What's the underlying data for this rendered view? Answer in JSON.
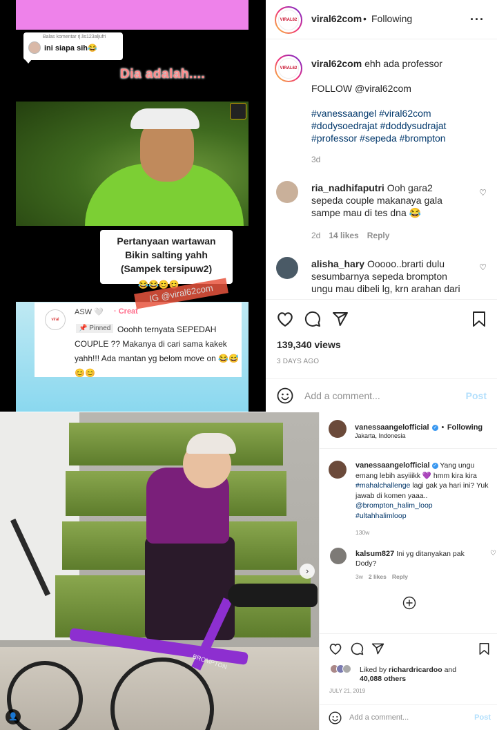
{
  "post1": {
    "media": {
      "reply_context": "Balas komentar rj.lis123aljufri",
      "reply_text": "ini siapa sih😂",
      "headline": "Dia adalah....",
      "caption_lines": [
        "Pertanyaan wartawan",
        "Bikin salting yahh",
        "(Sampek tersipuw2)"
      ],
      "caption_emojis": "😂😂😊😊",
      "watermark": "IG @viral62com",
      "pinned_author": "ASW 🤍",
      "pinned_creator": "· Creat",
      "pinned_label": "📌 Pinned",
      "pinned_text": "Ooohh ternyata SEPEDAH COUPLE ?? Makanya di cari sama kakek yahh!!! Ada mantan yg belom move on 😂😅😊😊",
      "avatar_label": "viral"
    },
    "header": {
      "username": "viral62com",
      "follow_status": "Following",
      "avatar_label": "VIRAL62"
    },
    "caption": {
      "username": "viral62com",
      "text": "ehh ada professor",
      "follow_line": "FOLLOW @viral62com",
      "hashtags": "#vanessaangel #viral62com #dodysoedrajat #doddysudrajat #professor #sepeda #brompton",
      "time": "3d"
    },
    "comments": [
      {
        "username": "ria_nadhifaputri",
        "text": "Ooh gara2 sepeda couple makanaya gala sampe mau di tes dna 😂",
        "time": "2d",
        "likes": "14 likes",
        "reply": "Reply"
      },
      {
        "username": "alisha_hary",
        "text": "Ooooo..brarti dulu sesumbarnya sepeda brompton ungu mau dibeli lg, krn arahan dari",
        "time": "",
        "likes": "",
        "reply": ""
      }
    ],
    "views": "139,340 views",
    "ago": "3 DAYS AGO",
    "add_comment_placeholder": "Add a comment...",
    "post_label": "Post"
  },
  "post2": {
    "header": {
      "username": "vanessaangelofficial",
      "follow_status": "Following",
      "location": "Jakarta, Indonesia"
    },
    "caption": {
      "username": "vanessaangelofficial",
      "text": "Yang ungu emang lebih asyiiikk 💜 hmm kira kira",
      "tags": "#mahalchallenge",
      "text2": "lagi gak ya hari ini? Yuk jawab di komen yaaa..",
      "mentions": "@brompton_halim_loop",
      "tags2": "#ultahhalimloop",
      "time": "130w"
    },
    "comment": {
      "username": "kalsum827",
      "text": "Ini yg ditanyakan pak Dody?",
      "time": "3w",
      "likes": "2 likes",
      "reply": "Reply"
    },
    "liked_by_prefix": "Liked by",
    "liked_by_user": "richardricardoo",
    "liked_by_and": "and",
    "liked_by_others": "40,088 others",
    "date": "JULY 21, 2019",
    "add_comment_placeholder": "Add a comment...",
    "post_label": "Post",
    "bike_brand": "BROMPTON"
  },
  "colors": {
    "link": "#00376b",
    "muted": "#8e8e8e",
    "post_disabled": "#b2dffc",
    "verified": "#3897f0"
  }
}
